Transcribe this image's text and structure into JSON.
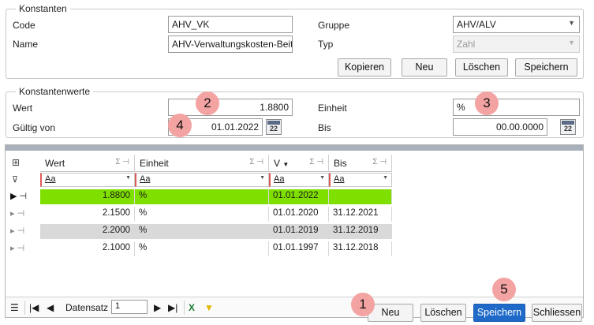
{
  "konstanten": {
    "title": "Konstanten",
    "code_label": "Code",
    "code_value": "AHV_VK",
    "name_label": "Name",
    "name_value": "AHV-Verwaltungskosten-Beit",
    "gruppe_label": "Gruppe",
    "gruppe_value": "AHV/ALV",
    "typ_label": "Typ",
    "typ_value": "Zahl",
    "buttons": [
      "Kopieren",
      "Neu",
      "Löschen",
      "Speichern"
    ]
  },
  "konstantenwerte": {
    "title": "Konstantenwerte",
    "wert_label": "Wert",
    "wert_value": "1.8800",
    "einheit_label": "Einheit",
    "einheit_value": "%",
    "gueltig_label": "Gültig von",
    "gueltig_value": "01.01.2022",
    "bis_label": "Bis",
    "bis_value": "00.00.0000",
    "cal_num": "22"
  },
  "grid": {
    "columns": [
      "Wert",
      "Einheit",
      "V",
      "Bis"
    ],
    "filter_text": "Aa",
    "rows": [
      {
        "wert": "1.8800",
        "einheit": "%",
        "von": "01.01.2022",
        "bis": ""
      },
      {
        "wert": "2.1500",
        "einheit": "%",
        "von": "01.01.2020",
        "bis": "31.12.2021"
      },
      {
        "wert": "2.2000",
        "einheit": "%",
        "von": "01.01.2019",
        "bis": "31.12.2019"
      },
      {
        "wert": "2.1000",
        "einheit": "%",
        "von": "01.01.1997",
        "bis": "31.12.2018"
      }
    ],
    "nav_label": "Datensatz",
    "nav_value": "1"
  },
  "footer": {
    "buttons": [
      "Neu",
      "Löschen",
      "Speichern",
      "Schliessen"
    ]
  },
  "badges": [
    "1",
    "2",
    "3",
    "4",
    "5"
  ],
  "colors": {
    "selected_row": "#7fe000",
    "alt_row": "#d9d9d9",
    "primary_button": "#1f6ac8",
    "badge": "#f4a3a3"
  }
}
